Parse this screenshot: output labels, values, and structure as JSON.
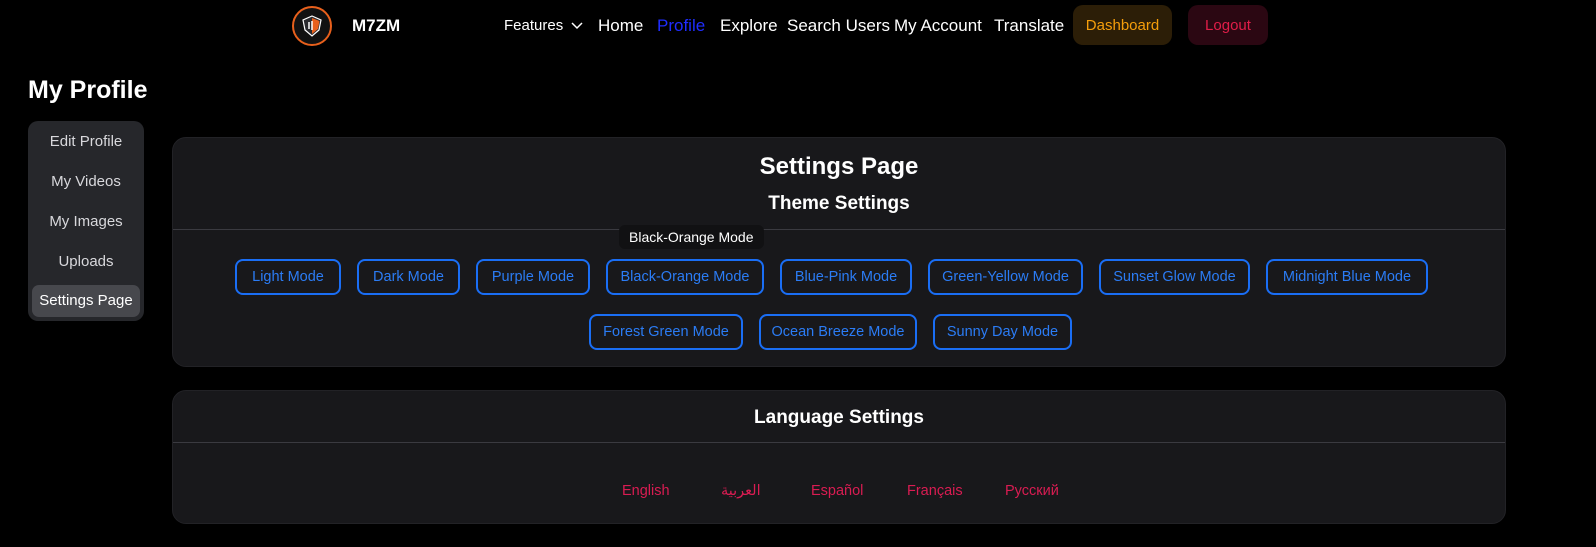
{
  "nav": {
    "brand": "M7ZM",
    "features": "Features",
    "home": "Home",
    "profile": "Profile",
    "explore": "Explore",
    "search_users": "Search Users",
    "my_account": "My Account",
    "translate": "Translate",
    "dashboard": "Dashboard",
    "logout": "Logout"
  },
  "page_title": "My Profile",
  "sidebar": {
    "items": [
      {
        "label": "Edit Profile"
      },
      {
        "label": "My Videos"
      },
      {
        "label": "My Images"
      },
      {
        "label": "Uploads"
      },
      {
        "label": "Settings Page"
      }
    ]
  },
  "settings": {
    "title": "Settings Page",
    "theme_title": "Theme Settings",
    "tooltip": "Black-Orange Mode",
    "themes": [
      {
        "label": "Light Mode"
      },
      {
        "label": "Dark Mode"
      },
      {
        "label": "Purple Mode"
      },
      {
        "label": "Black-Orange Mode"
      },
      {
        "label": "Blue-Pink Mode"
      },
      {
        "label": "Green-Yellow Mode"
      },
      {
        "label": "Sunset Glow Mode"
      },
      {
        "label": "Midnight Blue Mode"
      },
      {
        "label": "Forest Green Mode"
      },
      {
        "label": "Ocean Breeze Mode"
      },
      {
        "label": "Sunny Day Mode"
      }
    ]
  },
  "language": {
    "title": "Language Settings",
    "items": [
      {
        "label": "English"
      },
      {
        "label": "العربية"
      },
      {
        "label": "Español"
      },
      {
        "label": "Français"
      },
      {
        "label": "Русский"
      }
    ]
  },
  "colors": {
    "accent_blue": "#1a6ef5",
    "active_link": "#1f2dff",
    "dashboard": "#f59e0b",
    "logout": "#e11d48",
    "language_link": "#d91c52",
    "logo_ring": "#e8601c"
  }
}
